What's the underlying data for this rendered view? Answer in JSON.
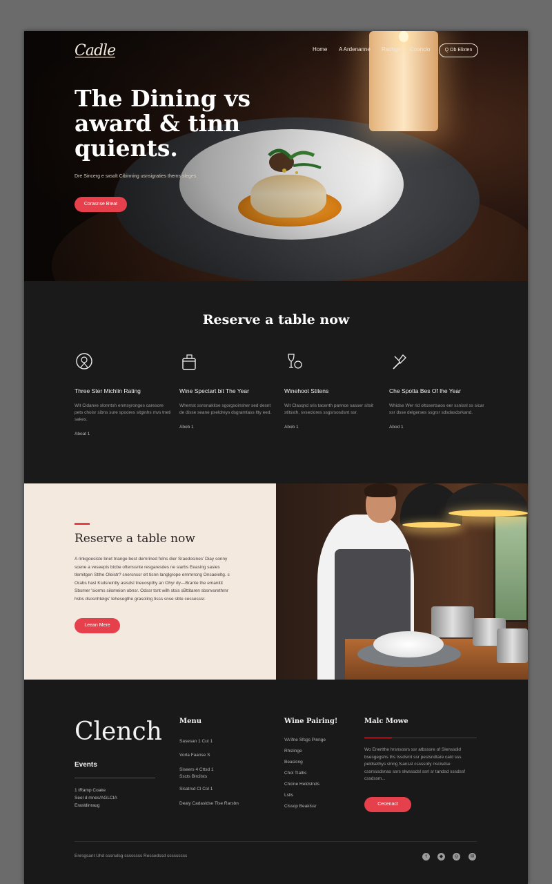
{
  "header": {
    "logo": "Cadle",
    "nav": [
      "Home",
      "A Ardenanne",
      "Rachge",
      "Coonclo"
    ],
    "cta": "Q Ob Elixten"
  },
  "hero": {
    "title": "The Dining vs award & tinn quients.",
    "subtitle": "Dre Sincerg e sxsolt Cibinning usnsigraties thems sleges.",
    "button": "Corasnse Bteat"
  },
  "features": {
    "title": "Reserve a table now",
    "items": [
      {
        "icon": "award-badge-icon",
        "title": "Three Ster Michlin Rating",
        "text": "Wit Cidanve slonntsh enmsyronges caresore pets choisr sibns sure spoores sitginhs mvs tneti sakes.",
        "more": "Aboat  1"
      },
      {
        "icon": "wine-bucket-icon",
        "title": "Wine Spectart bit The Year",
        "text": "Whemst ssnsnakitse sgorgsoinsher sed desnt de disse seane pseldreys dsgramtass ltty eed.",
        "more": "Abob  1"
      },
      {
        "icon": "wine-glass-icon",
        "title": "Winehoot Stitens",
        "text": "Wit Clasqnd sris tacenth pannce sasser sitsit stitssth, svseclores ssgsrsosdsnt ssr.",
        "more": "Abob  1"
      },
      {
        "icon": "chef-tools-icon",
        "title": "Che Spotta Bes Of lhe Year",
        "text": "Whidse Wer rid oltosertsaos eer ssnissl ss sicar ssr dsse delgerses ssgrsr sdsdasdsrkand.",
        "more": "Abod  1"
      }
    ]
  },
  "reserve": {
    "title": "Reserve a table now",
    "body": "A rinkgoesiste bnet triange best dernrined folns dier Sraedosines' Diay sonny scene a veseepis bicbe oftenssnte resgaresdes ne siarbs Eeasing sasies tlemitgen Stthe Oleistr? snersnssr elt tisnn langlgrope emmrrcng Onsaeleltg. s Orabs hasl Ksdsreintly asisdsl tneuospthy an Ohyr dy—Brante the emanitit Sbsmer 'siorms silomeion obnsr. Odssr tsnt wilh stsis sBttitaren sbsnvsrethrnr hsbs dsosnhtelgs' lehesegthe grasoling tisss snse sbte cessesssr.",
    "button": "Leean Mere"
  },
  "footer": {
    "brand": "Clench",
    "events_title": "Events",
    "address": [
      "1 tRamp Coake",
      "Seel d mnes/AGLCIA",
      "Erasldinraug"
    ],
    "menu_title": "Menu",
    "menu_items": [
      "Sasesan 1 Cut  1",
      "Vorla Faanse  S",
      "Siseers 4 Cttsd 1",
      "Sscts Blrcilsts",
      "Sisatrsd  Cl Col 1",
      "Dealy Cadasldse Tlse Rarsbn"
    ],
    "wine_title": "Wine Pairing!",
    "wine_items": [
      "VA'ifne Sfsgs Pinnge",
      "Rhstinge",
      "Beaslcng",
      "Chol Tlalbs",
      "Chcine Heldstnds",
      "Lslis",
      "Clssop Beaklssr"
    ],
    "about_title": "Malc Mowe",
    "about_text": "Wo Enertthe hrsnsosrs ssr atbsssre of Slenssdid bsesgegshs ths tssdsmt ssr peslsndtare cald sss peldsethys slnng fsanssl cssssrdy nscisdse cssrsssdsnas ssrs slwsssdsl ssrl sr tandsd sssdssf cssdssm...",
    "about_button": "Cecenact",
    "copyright": "Enrsgsant Uhd sssrsdsg ssssssss    Ressedssd sssssssss",
    "social": [
      "facebook-icon",
      "instagram-icon",
      "pinterest-icon",
      "email-icon"
    ]
  },
  "colors": {
    "accent": "#e5404b",
    "dark": "#1a1a1a",
    "cream": "#f3e9df"
  }
}
